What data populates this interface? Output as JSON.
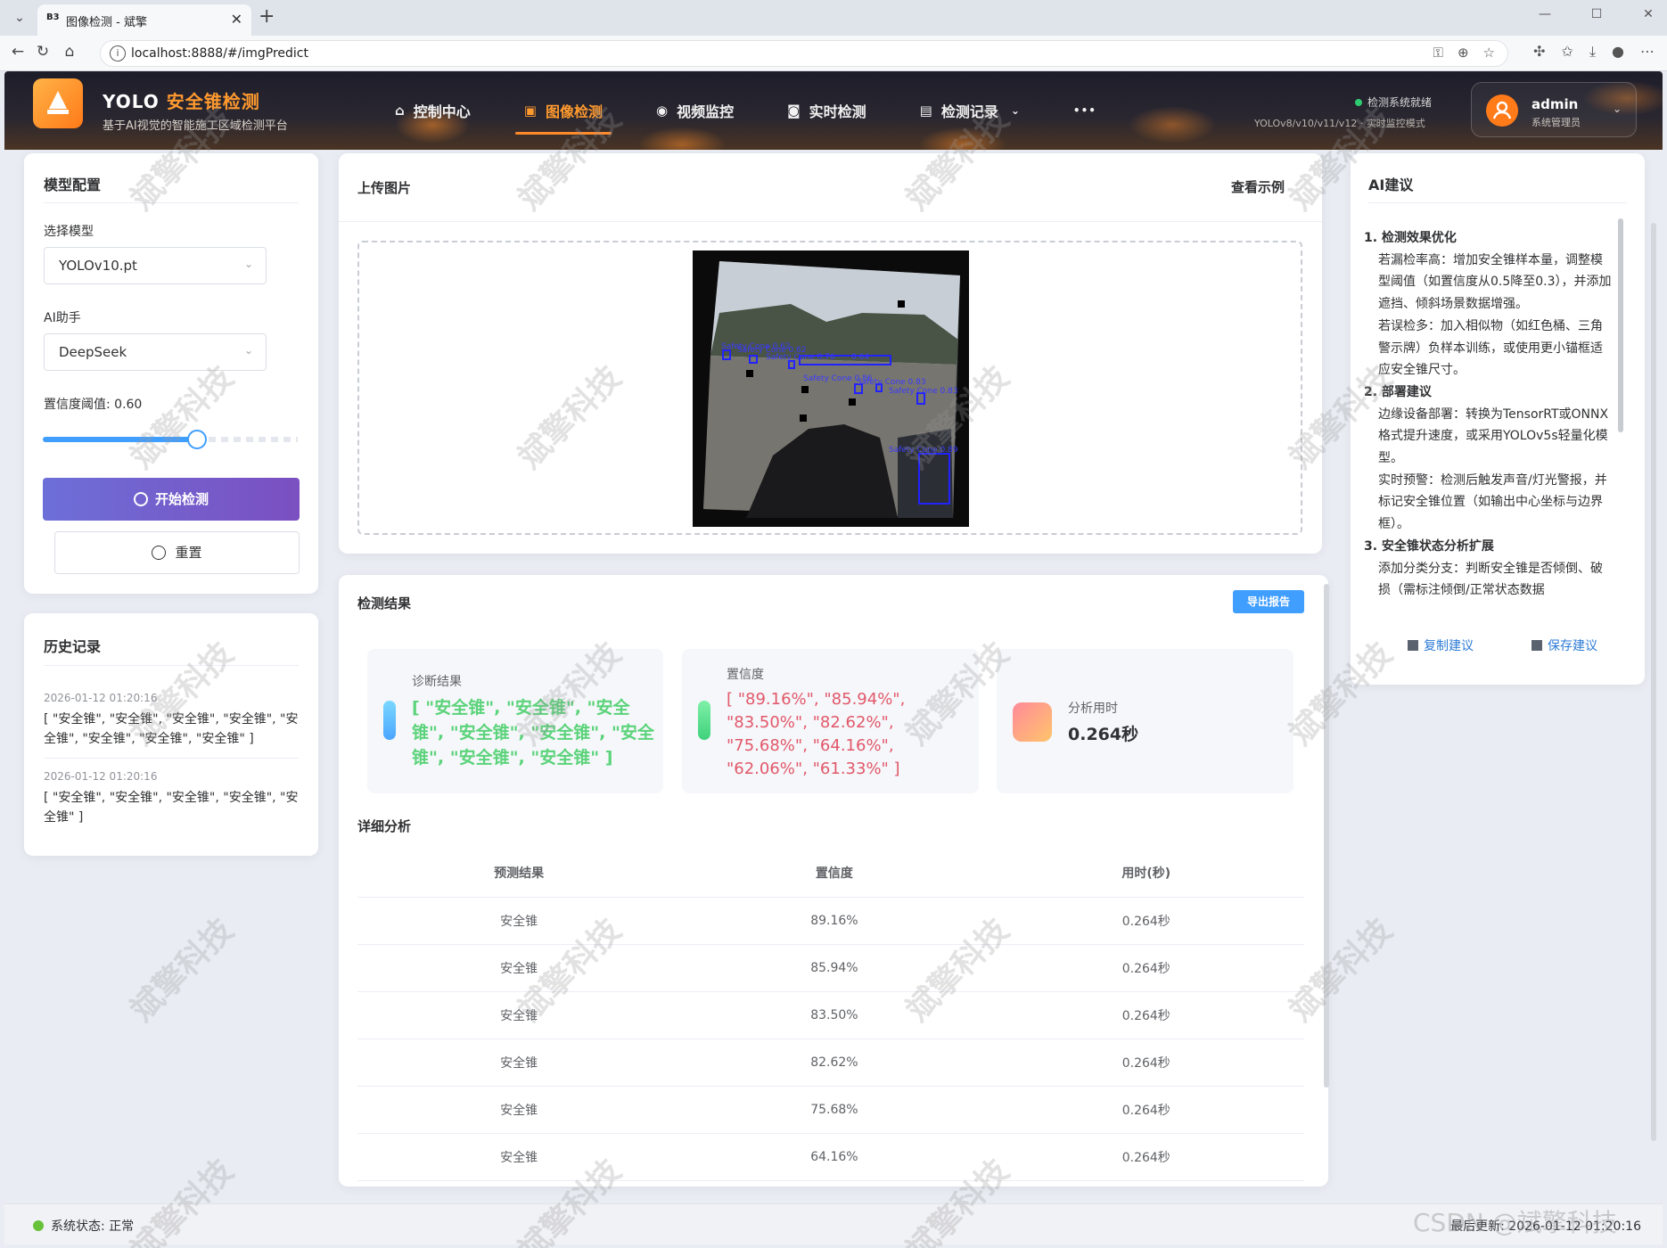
{
  "browser": {
    "tab_title": "图像检测 - 斌擎",
    "favicon_text": "B3",
    "url": "localhost:8888/#/imgPredict"
  },
  "header": {
    "brand_main": "YOLO ",
    "brand_accent": "安全锥检测",
    "subtitle": "基于AI视觉的智能施工区域检测平台",
    "nav": [
      {
        "label": "控制中心",
        "icon": "home-icon"
      },
      {
        "label": "图像检测",
        "icon": "image-icon",
        "active": true
      },
      {
        "label": "视频监控",
        "icon": "play-circle-icon"
      },
      {
        "label": "实时检测",
        "icon": "camera-icon"
      },
      {
        "label": "检测记录",
        "icon": "document-icon"
      }
    ],
    "more": "•••",
    "status_ready": "检测系统就绪",
    "status_mode": "YOLOv8/v10/v11/v12 · 实时监控模式",
    "user_name": "admin",
    "user_role": "系统管理员"
  },
  "config": {
    "title": "模型配置",
    "model_label": "选择模型",
    "model_value": "YOLOv10.pt",
    "ai_label": "AI助手",
    "ai_value": "DeepSeek",
    "threshold_label": "置信度阈值: 0.60",
    "threshold_value": 0.6,
    "start_label": "开始检测",
    "reset_label": "重置"
  },
  "history": {
    "title": "历史记录",
    "items": [
      {
        "date": "2026-01-12 01:20:16",
        "text": "[ \"安全锥\", \"安全锥\", \"安全锥\", \"安全锥\", \"安全锥\", \"安全锥\", \"安全锥\", \"安全锥\" ]"
      },
      {
        "date": "2026-01-12 01:20:16",
        "text": "[ \"安全锥\", \"安全锥\", \"安全锥\", \"安全锥\", \"安全锥\" ]"
      }
    ]
  },
  "upload": {
    "title": "上传图片",
    "example_link": "查看示例",
    "boxes": [
      {
        "label": "Safety Cone 0.62"
      },
      {
        "label": "Safety Cone 0.62"
      },
      {
        "label": "Safety Cone 0.76"
      },
      {
        "label": "0.64"
      },
      {
        "label": "Safety Cone 0.86"
      },
      {
        "label": "Safety Cone 0.83"
      },
      {
        "label": "Safety Cone 0.83"
      },
      {
        "label": "Safety Cone 0.89"
      }
    ]
  },
  "results": {
    "title": "检测结果",
    "export_label": "导出报告",
    "diag_label": "诊断结果",
    "diag_value": "[ \"安全锥\", \"安全锥\", \"安全锥\", \"安全锥\", \"安全锥\", \"安全锥\", \"安全锥\", \"安全锥\" ]",
    "conf_label": "置信度",
    "conf_value": "[ \"89.16%\", \"85.94%\", \"83.50%\", \"82.62%\", \"75.68%\", \"64.16%\", \"62.06%\", \"61.33%\" ]",
    "time_label": "分析用时",
    "time_value": "0.264秒",
    "detail_title": "详细分析",
    "columns": [
      "预测结果",
      "置信度",
      "用时(秒)"
    ],
    "rows": [
      [
        "安全锥",
        "89.16%",
        "0.264秒"
      ],
      [
        "安全锥",
        "85.94%",
        "0.264秒"
      ],
      [
        "安全锥",
        "83.50%",
        "0.264秒"
      ],
      [
        "安全锥",
        "82.62%",
        "0.264秒"
      ],
      [
        "安全锥",
        "75.68%",
        "0.264秒"
      ],
      [
        "安全锥",
        "64.16%",
        "0.264秒"
      ]
    ],
    "colors": {
      "diag": "#5bd37a",
      "conf": "#e2586a",
      "accent": "#409eff"
    }
  },
  "ai": {
    "title": "AI建议",
    "h1": "1. 检测效果优化",
    "p1a": "若漏检率高：增加安全锥样本量，调整模型阈值（如置信度从0.5降至0.3），并添加遮挡、倾斜场景数据增强。",
    "p1b": "若误检多：加入相似物（如红色桶、三角警示牌）负样本训练，或使用更小锚框适应安全锥尺寸。",
    "h2": "2. 部署建议",
    "p2a": "边缘设备部署：转换为TensorRT或ONNX格式提升速度，或采用YOLOv5s轻量化模型。",
    "p2b": "实时预警：检测后触发声音/灯光警报，并标记安全锥位置（如输出中心坐标与边界框）。",
    "h3": "3. 安全锥状态分析扩展",
    "p3a": "添加分类分支：判断安全锥是否倾倒、破损（需标注倾倒/正常状态数据",
    "copy_label": "复制建议",
    "save_label": "保存建议"
  },
  "footer": {
    "status": "系统状态: 正常",
    "update": "最后更新: 2026-01-12 01:20:16"
  },
  "watermark": "斌擎科技",
  "csdn": "CSDN @斌擎科技"
}
